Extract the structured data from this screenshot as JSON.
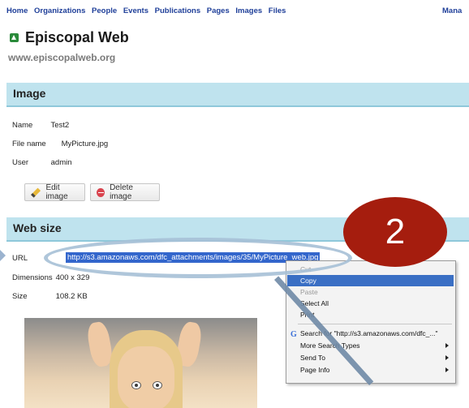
{
  "nav": {
    "items": [
      "Home",
      "Organizations",
      "People",
      "Events",
      "Publications",
      "Pages",
      "Images",
      "Files"
    ],
    "right": "Mana"
  },
  "site": {
    "name": "Episcopal Web",
    "url": "www.episcopalweb.org"
  },
  "image_section": {
    "title": "Image",
    "fields": [
      {
        "label": "Name",
        "value": "Test2"
      },
      {
        "label": "File name",
        "value": "MyPicture.jpg"
      },
      {
        "label": "User",
        "value": "admin"
      }
    ],
    "edit_label": "Edit image",
    "delete_label": "Delete image"
  },
  "web_size": {
    "title": "Web size",
    "url_label": "URL",
    "url_value": "http://s3.amazonaws.com/dfc_attachments/images/35/MyPicture_web.jpg",
    "dimensions_label": "Dimensions",
    "dimensions_value": "400 x 329",
    "size_label": "Size",
    "size_value": "108.2 KB"
  },
  "context_menu": {
    "cut": "Cut",
    "copy": "Copy",
    "paste": "Paste",
    "select_all": "Select All",
    "print": "Print",
    "search": "Search for \"http://s3.amazonaws.com/dfc_...\"",
    "more_search": "More Search Types",
    "send_to": "Send To",
    "page_info": "Page Info"
  },
  "callout": {
    "step": "2",
    "color": "#a51d0e"
  }
}
